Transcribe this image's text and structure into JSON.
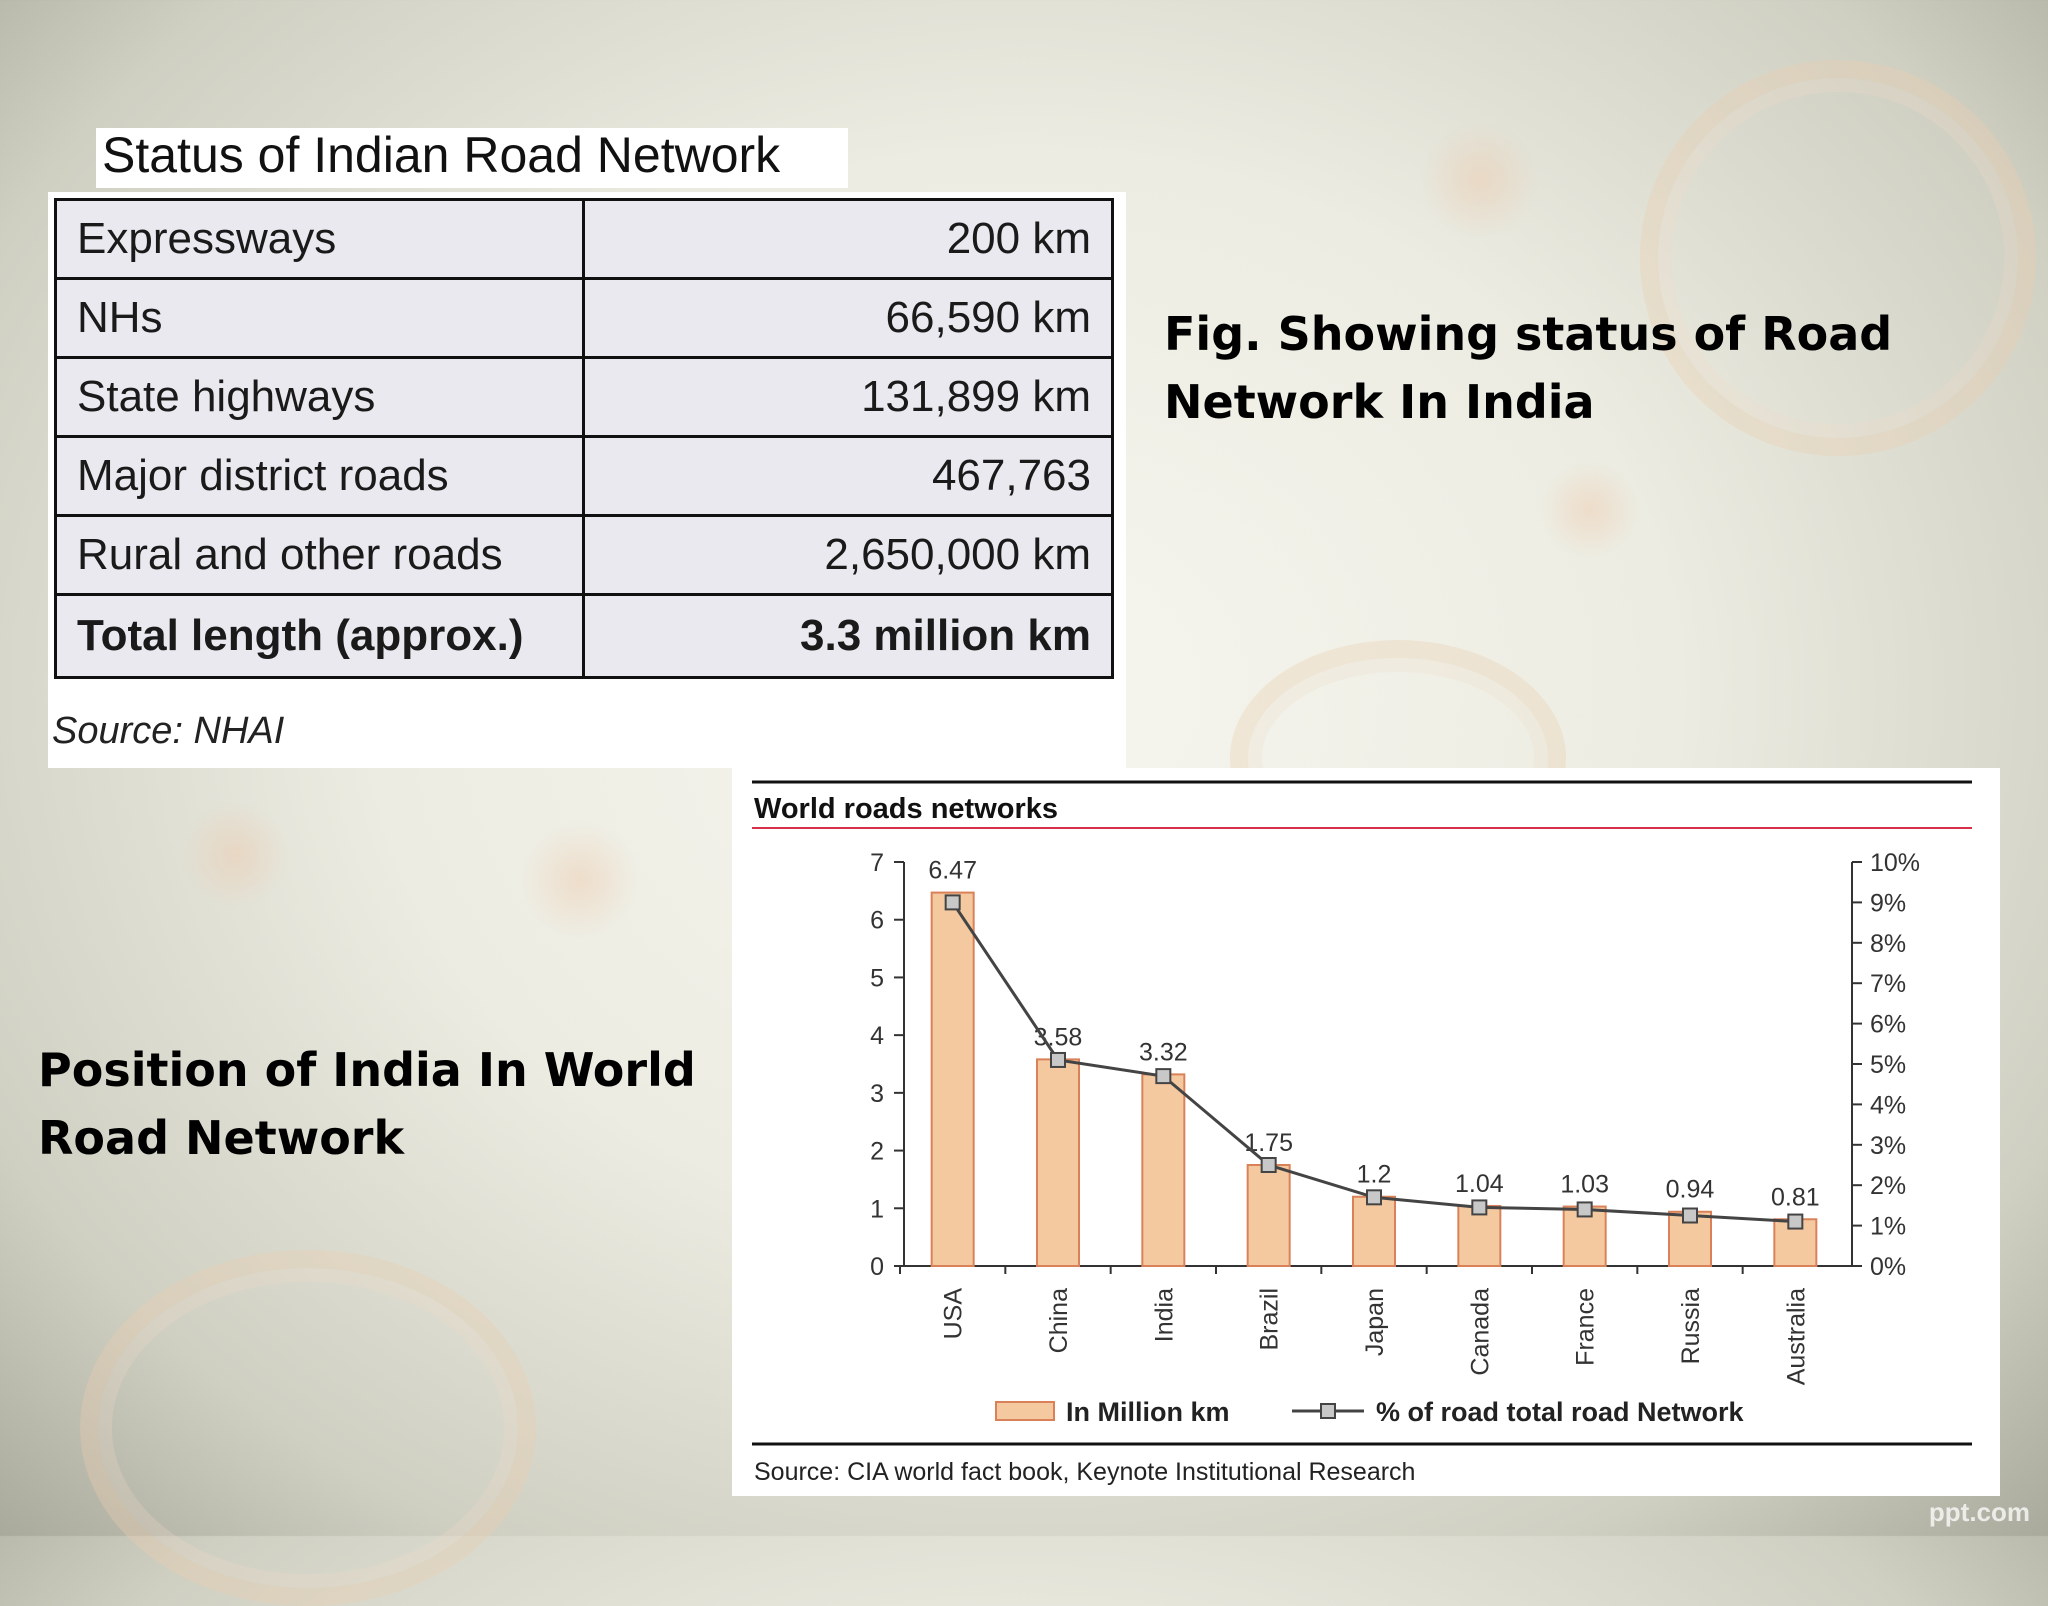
{
  "road_table": {
    "title": "Status of Indian Road Network",
    "rows": [
      {
        "name": "Expressways",
        "value": "200 km"
      },
      {
        "name": "NHs",
        "value": "66,590 km"
      },
      {
        "name": "State highways",
        "value": "131,899 km"
      },
      {
        "name": "Major district roads",
        "value": "467,763"
      },
      {
        "name": "Rural and other roads",
        "value": "2,650,000 km"
      }
    ],
    "total": {
      "name": "Total length (approx.)",
      "value": "3.3 million km"
    },
    "source": "Source: NHAI"
  },
  "captions": {
    "fig": "Fig. Showing status of Road Network In India",
    "position": "Position of India In World Road Network"
  },
  "chart_data": {
    "type": "bar",
    "title": "World roads networks",
    "categories": [
      "USA",
      "China",
      "India",
      "Brazil",
      "Japan",
      "Canada",
      "France",
      "Russia",
      "Australia"
    ],
    "series": [
      {
        "name": "In Million km",
        "type": "bar",
        "axis": "left",
        "values": [
          6.47,
          3.58,
          3.32,
          1.75,
          1.2,
          1.04,
          1.03,
          0.94,
          0.81
        ],
        "labels": [
          "6.47",
          "3.58",
          "3.32",
          "1.75",
          "1.2",
          "1.04",
          "1.03",
          "0.94",
          "0.81"
        ]
      },
      {
        "name": "% of road total road Network",
        "type": "line",
        "axis": "right",
        "values": [
          9.0,
          5.1,
          4.7,
          2.5,
          1.7,
          1.45,
          1.4,
          1.25,
          1.1
        ]
      }
    ],
    "ylim_left": [
      0,
      7
    ],
    "yticks_left": [
      "0",
      "1",
      "2",
      "3",
      "4",
      "5",
      "6",
      "7"
    ],
    "ylim_right": [
      0,
      10
    ],
    "yticks_right": [
      "0%",
      "1%",
      "2%",
      "3%",
      "4%",
      "5%",
      "6%",
      "7%",
      "8%",
      "9%",
      "10%"
    ],
    "legend_position": "bottom",
    "grid": false,
    "source": "Source: CIA world fact book, Keynote Institutional Research",
    "colors": {
      "bar_fill": "#f5c9a0",
      "bar_stroke": "#d9825a",
      "line": "#444444",
      "marker_fill": "#c8c8c8",
      "title_rule": "#d9304a"
    }
  },
  "watermark": "ppt.com"
}
